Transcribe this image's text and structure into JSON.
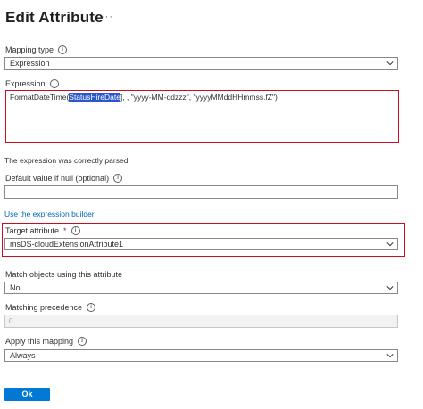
{
  "dialog": {
    "title": "Edit Attribute",
    "more_menu": "···"
  },
  "mapping_type": {
    "label": "Mapping type",
    "value": "Expression"
  },
  "expression": {
    "label": "Expression",
    "prefix": "FormatDateTime(",
    "highlight": "StatusHireDate",
    "suffix": "], , \"yyyy-MM-ddzzz\", \"yyyyMMddHHmmss.fZ\")"
  },
  "parse_message": "The expression was correctly parsed.",
  "default_value": {
    "label": "Default value if null (optional)",
    "value": ""
  },
  "expression_builder_link": "Use the expression builder",
  "target_attribute": {
    "label": "Target attribute",
    "required_mark": "*",
    "value": "msDS-cloudExtensionAttribute1"
  },
  "match_objects": {
    "label": "Match objects using this attribute",
    "value": "No"
  },
  "matching_precedence": {
    "label": "Matching precedence",
    "value": "0"
  },
  "apply_mapping": {
    "label": "Apply this mapping",
    "value": "Always"
  },
  "ok_button": "Ok",
  "info_glyph": "i",
  "colors": {
    "accent": "#0078d4",
    "link": "#0067b8",
    "highlight_outline": "#c50f1f",
    "selection": "#2b57c9"
  }
}
